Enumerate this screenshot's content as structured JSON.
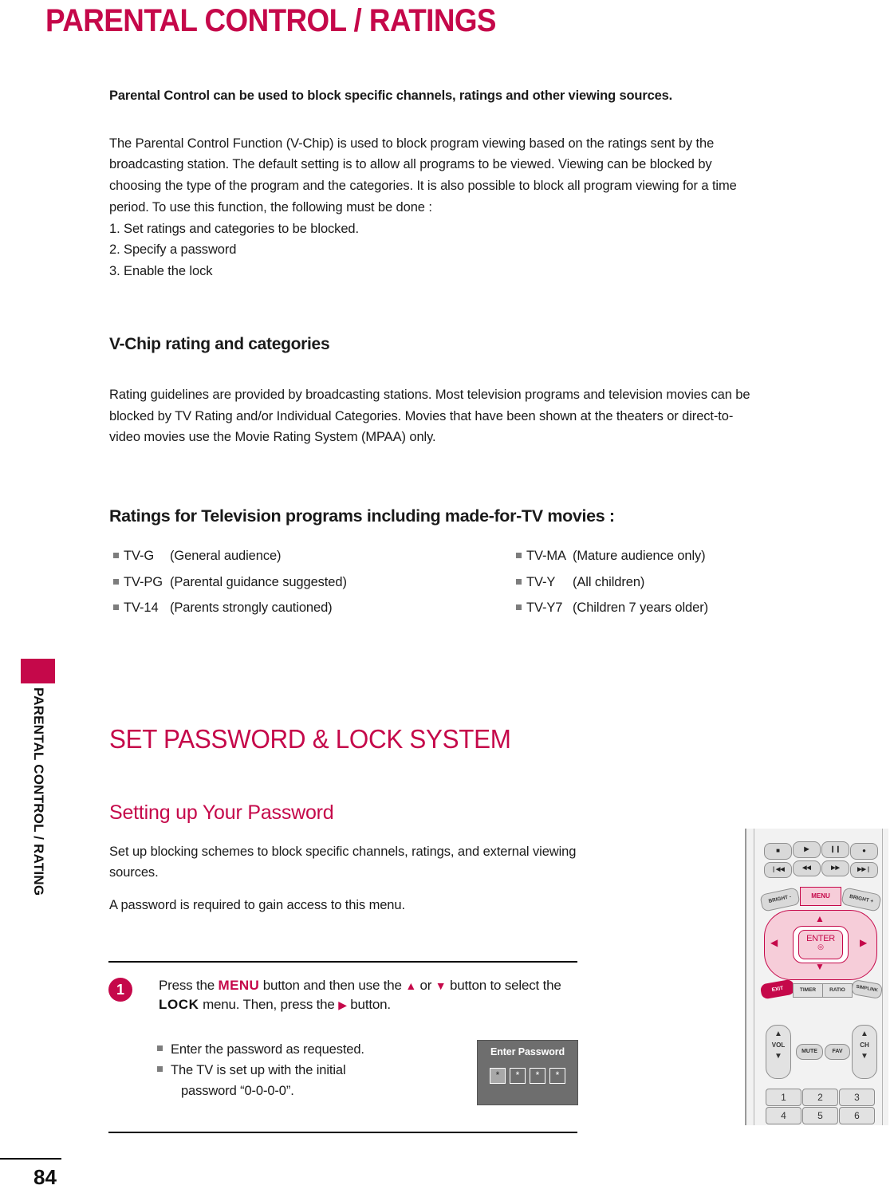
{
  "page": {
    "title": "PARENTAL CONTROL / RATINGS",
    "number": "84",
    "side_tab_label": "PARENTAL CONTROL / RATING",
    "accent_color": "#C5084A"
  },
  "intro": {
    "lead": "Parental Control can be used to block specific channels, ratings and other viewing sources.",
    "body": "The Parental Control Function (V-Chip) is used to block program viewing based on the ratings sent by the broadcasting station. The default setting is to allow all programs to be viewed. Viewing can be blocked by choosing the type of the program and the categories. It is also possible to block all program viewing for a time period. To use this function, the following must be done :",
    "steps": [
      "1. Set ratings and categories to be blocked.",
      "2. Specify a password",
      "3. Enable the lock"
    ]
  },
  "vchip": {
    "heading": "V-Chip rating and categories",
    "body": "Rating guidelines are provided by broadcasting stations. Most television programs and television movies can be blocked by TV Rating and/or Individual Categories. Movies that have been shown at the theaters or direct-to-video movies use the Movie Rating System (MPAA) only."
  },
  "ratings": {
    "heading": "Ratings for Television programs including made-for-TV movies :",
    "left_column": [
      {
        "code": "TV-G",
        "desc": "(General audience)"
      },
      {
        "code": "TV-PG",
        "desc": "(Parental guidance suggested)"
      },
      {
        "code": "TV-14",
        "desc": "(Parents strongly cautioned)"
      }
    ],
    "right_column": [
      {
        "code": "TV-MA",
        "desc": "(Mature audience only)"
      },
      {
        "code": "TV-Y",
        "desc": "(All children)"
      },
      {
        "code": "TV-Y7",
        "desc": "(Children 7 years older)"
      }
    ]
  },
  "password_section": {
    "heading": "SET PASSWORD & LOCK SYSTEM",
    "subheading": "Setting up Your Password",
    "para1": "Set up blocking schemes to block specific channels, ratings, and external viewing sources.",
    "para2": "A password is required to gain access to this menu."
  },
  "step1": {
    "badge": "1",
    "text_a": "Press the ",
    "kw_menu": "MENU",
    "text_b": " button and then use the ",
    "arrow_up": "▲",
    "text_c": " or ",
    "arrow_down": "▼",
    "text_d": " button to select the ",
    "kw_lock": "LOCK",
    "text_e": " menu. Then, press the ",
    "arrow_right": "▶",
    "text_f": " button.",
    "bullets": [
      "Enter the password as requested.",
      "The TV is set up with the initial"
    ],
    "bullet2_cont": "password “0-0-0-0”."
  },
  "osd": {
    "title": "Enter Password",
    "digits": [
      "*",
      "*",
      "*",
      "*"
    ]
  },
  "remote": {
    "transport_row1": [
      "■",
      "▶",
      "❙❙",
      "●"
    ],
    "transport_row2": [
      "❘◀◀",
      "◀◀",
      "▶▶",
      "▶▶❘"
    ],
    "bright_minus": "BRIGHT -",
    "menu": "MENU",
    "bright_plus": "BRIGHT +",
    "enter": "ENTER",
    "exit": "EXIT",
    "timer": "TIMER",
    "ratio": "RATIO",
    "simplink": "SIMPLINK",
    "vol": "VOL",
    "mute": "MUTE",
    "fav": "FAV",
    "ch": "CH",
    "numbers": [
      "1",
      "2",
      "3",
      "4",
      "5",
      "6"
    ]
  }
}
